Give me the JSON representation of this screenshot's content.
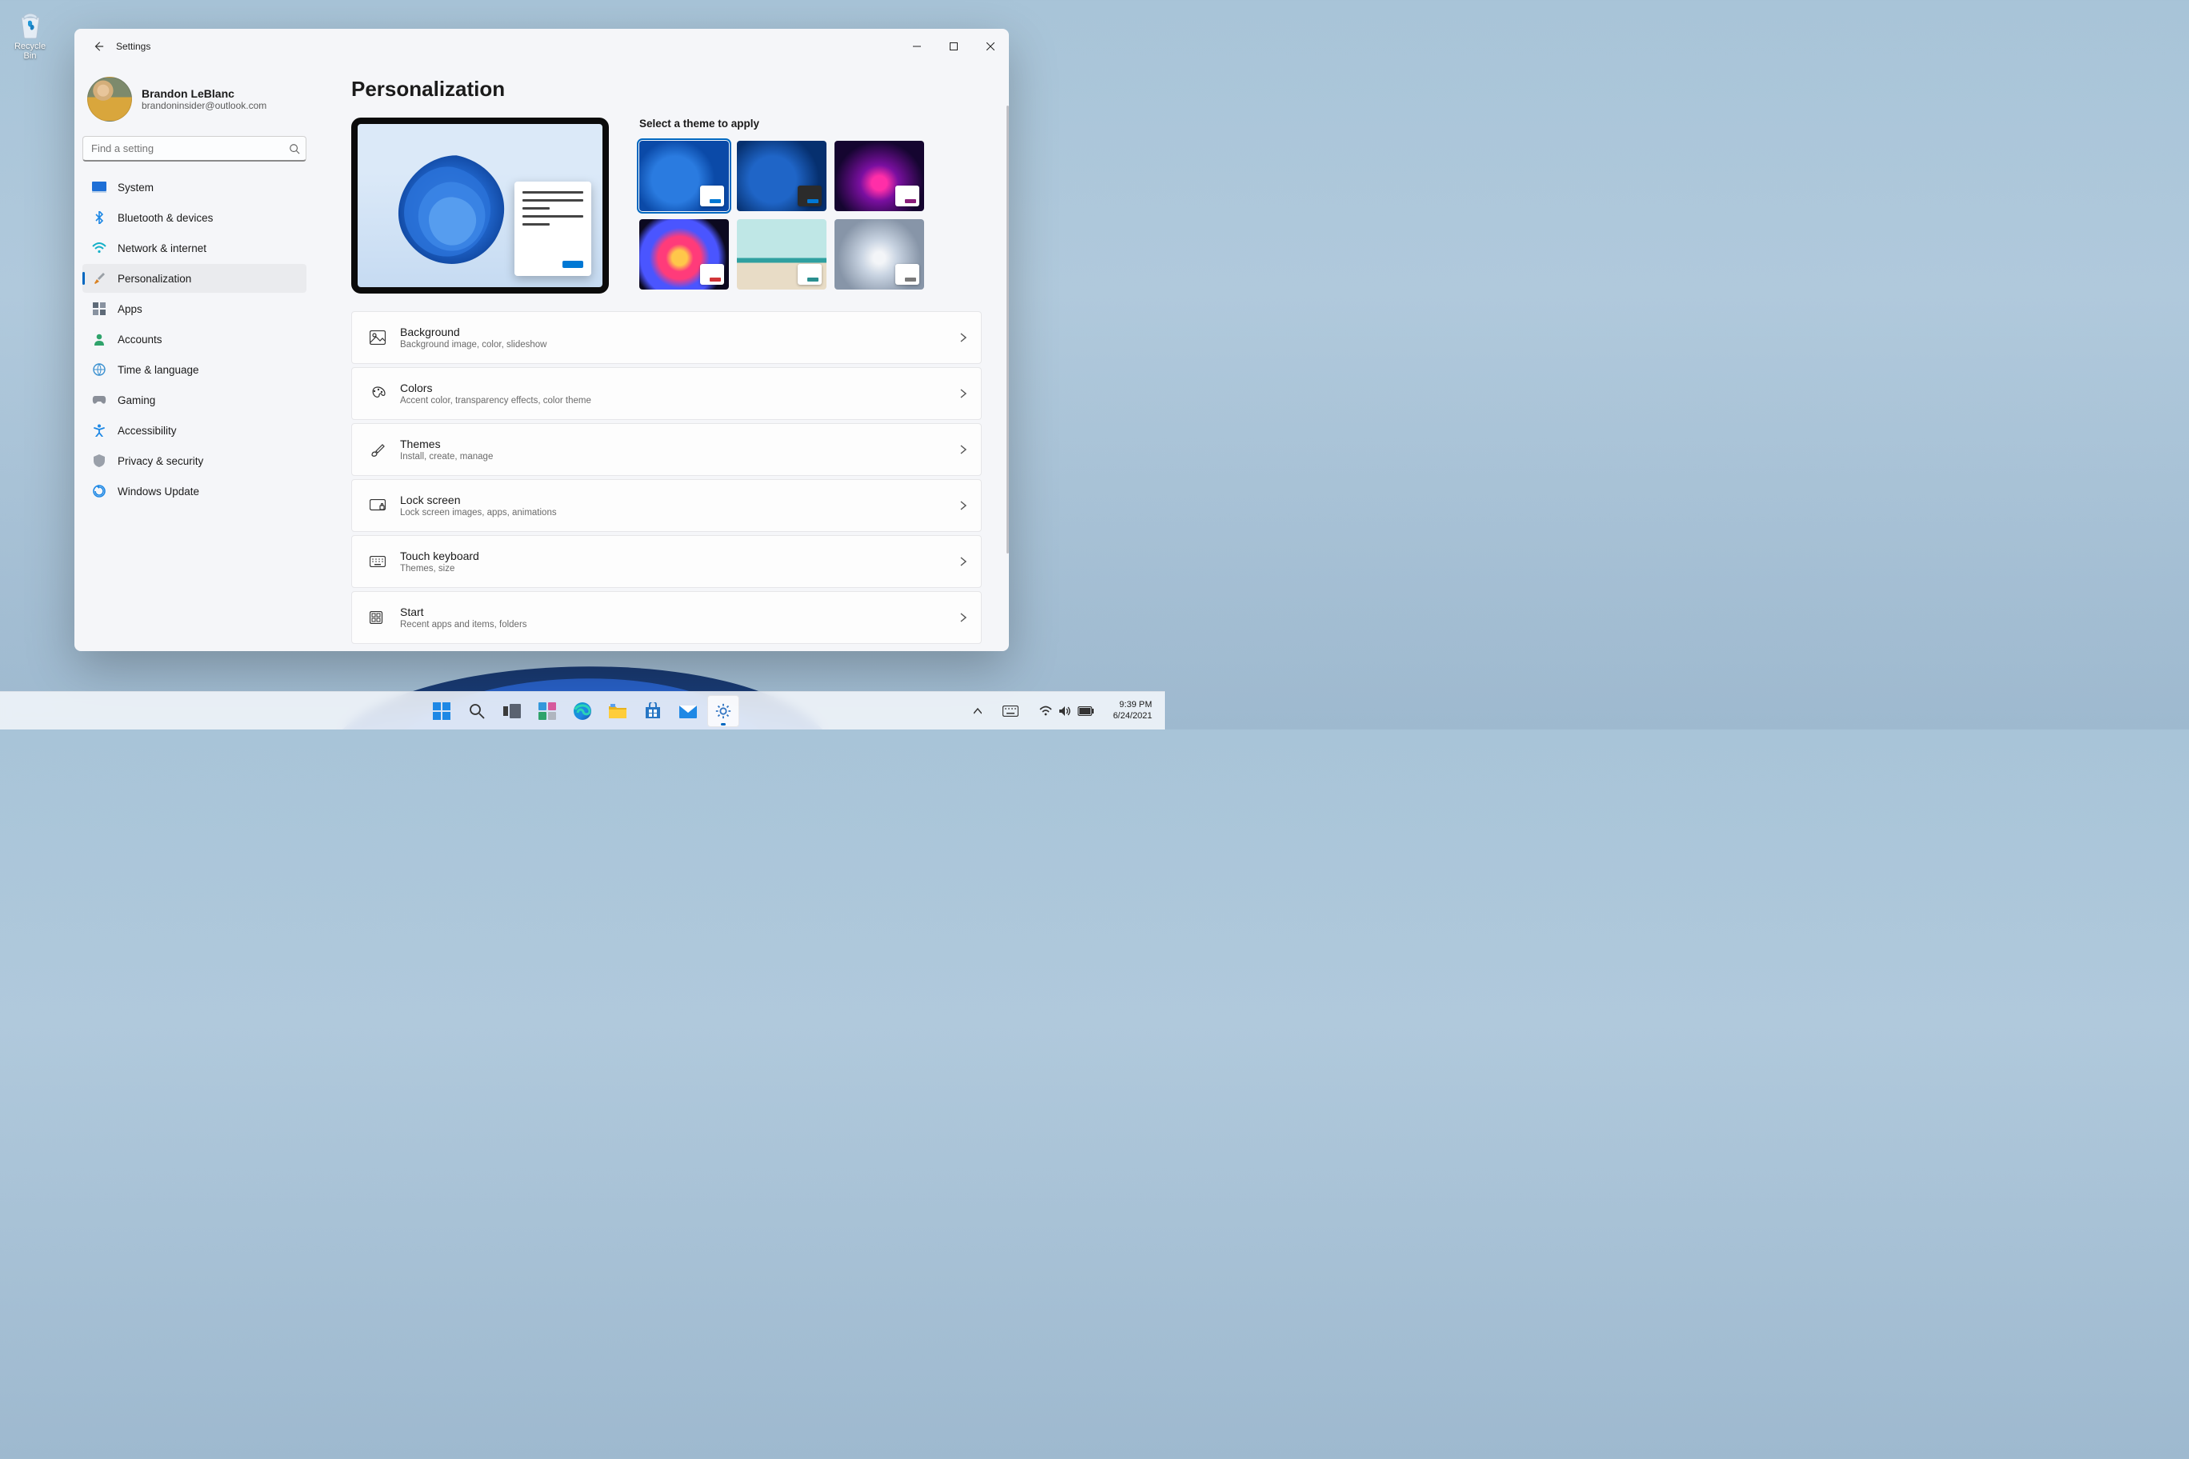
{
  "desktop": {
    "recycle_bin": "Recycle Bin"
  },
  "window": {
    "app_title": "Settings",
    "profile": {
      "name": "Brandon LeBlanc",
      "email": "brandoninsider@outlook.com"
    },
    "search": {
      "placeholder": "Find a setting"
    },
    "sidebar": [
      {
        "label": "System"
      },
      {
        "label": "Bluetooth & devices"
      },
      {
        "label": "Network & internet"
      },
      {
        "label": "Personalization"
      },
      {
        "label": "Apps"
      },
      {
        "label": "Accounts"
      },
      {
        "label": "Time & language"
      },
      {
        "label": "Gaming"
      },
      {
        "label": "Accessibility"
      },
      {
        "label": "Privacy & security"
      },
      {
        "label": "Windows Update"
      }
    ],
    "page_title": "Personalization",
    "themes_label": "Select a theme to apply",
    "rows": [
      {
        "title": "Background",
        "desc": "Background image, color, slideshow"
      },
      {
        "title": "Colors",
        "desc": "Accent color, transparency effects, color theme"
      },
      {
        "title": "Themes",
        "desc": "Install, create, manage"
      },
      {
        "title": "Lock screen",
        "desc": "Lock screen images, apps, animations"
      },
      {
        "title": "Touch keyboard",
        "desc": "Themes, size"
      },
      {
        "title": "Start",
        "desc": "Recent apps and items, folders"
      }
    ]
  },
  "taskbar": {
    "time": "9:39 PM",
    "date": "6/24/2021"
  },
  "colors": {
    "accent": "#0067c0"
  }
}
